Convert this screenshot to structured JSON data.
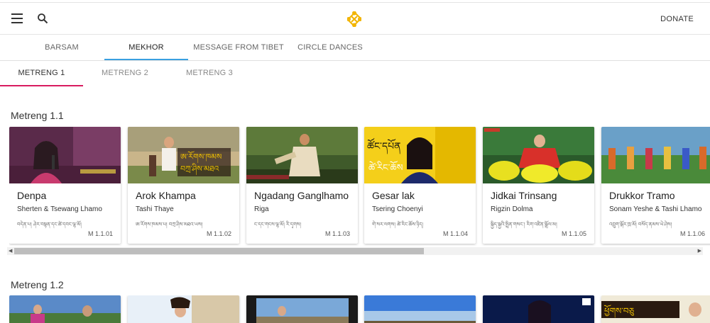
{
  "header": {
    "menu_icon": "hamburger-menu-icon",
    "search_icon": "search-icon",
    "logo_icon": "endless-knot-icon",
    "logo_color": "#f2b400",
    "donate_label": "DONATE"
  },
  "main_tabs": [
    "BARSAM",
    "MEKHOR",
    "MESSAGE FROM TIBET",
    "CIRCLE DANCES"
  ],
  "active_main_tab": "MEKHOR",
  "sub_tabs": [
    "METRENG 1",
    "METRENG 2",
    "METRENG 3"
  ],
  "active_sub_tab": "METRENG 1",
  "accent_colors": {
    "main_tab_indicator": "#3aa0e0",
    "sub_tab_indicator": "#d81b60"
  },
  "sections": [
    {
      "title": "Metreng 1.1",
      "cards": [
        {
          "title": "Denpa",
          "artist": "Sherten & Tsewang Lhamo",
          "tibetan": "བདེན་པ། ཤེར་བསྟན་དང་ཚེ་དབང་ལྷ་མོ།",
          "code": "M 1.1.01"
        },
        {
          "title": "Arok Khampa",
          "artist": "Tashi Thaye",
          "tibetan": "ཨ་རོགས་ཁམས་པ། བཀྲ་ཤིས་མཐའ་ཡས།",
          "code": "M 1.1.02"
        },
        {
          "title": "Ngadang Ganglhamo",
          "artist": "Riga",
          "tibetan": "ང་དང་གངས་ལྷ་མོ། རི་དྭགས།",
          "code": "M 1.1.03"
        },
        {
          "title": "Gesar lak",
          "artist": "Tsering Choenyi",
          "tibetan": "གེ་སར་ལགས། ཚེ་རིང་ཆོས་ཉིད།",
          "code": "M 1.1.04"
        },
        {
          "title": "Jidkai Trinsang",
          "artist": "Rigzin Dolma",
          "tibetan": "སྐྱིད་སྐྱའི་སྤྲིན་གསང་། རིག་འཛིན་སྒྲོལ་མ།",
          "code": "M 1.1.05"
        },
        {
          "title": "Drukkor Tramo",
          "artist": "Sonam Yeshe & Tashi Lhamo",
          "tibetan": "འབྲུག་སྐོར་ཁྲ་མོ། བསོད་ནམས་ཡེ་ཤེས།",
          "code": "M 1.1.06"
        }
      ]
    },
    {
      "title": "Metreng 1.2",
      "cards": [
        {
          "title": "",
          "artist": "",
          "tibetan": "",
          "code": ""
        },
        {
          "title": "",
          "artist": "",
          "tibetan": "",
          "code": ""
        },
        {
          "title": "",
          "artist": "",
          "tibetan": "",
          "code": ""
        },
        {
          "title": "",
          "artist": "",
          "tibetan": "",
          "code": ""
        },
        {
          "title": "",
          "artist": "",
          "tibetan": "",
          "code": ""
        },
        {
          "title": "",
          "artist": "",
          "tibetan": "",
          "code": ""
        }
      ]
    }
  ],
  "scrollbar": {
    "position": 0.0,
    "visible_fraction": 0.59
  }
}
